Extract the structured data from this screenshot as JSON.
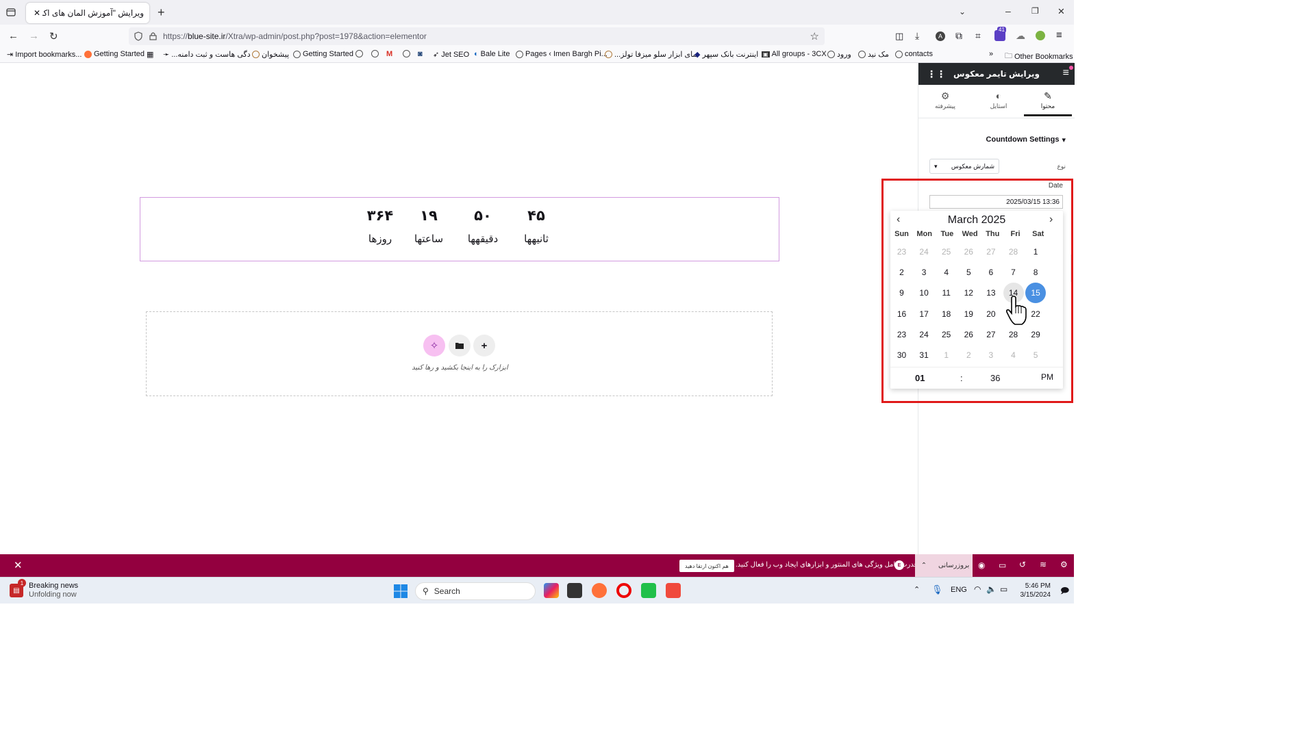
{
  "browser": {
    "tab_title": "ویرایش \"آموزش المان های اکسترا – ...",
    "url_prefix": "https://",
    "url_domain": "blue-site.ir",
    "url_path": "/Xtra/wp-admin/post.php?post=1978&action=elementor",
    "extension_badge": "41"
  },
  "bookmarks": {
    "items": [
      "Import bookmarks...",
      "Getting Started",
      "...دگی هاست و ثبت دامنه",
      "پیشخوان",
      "Getting Started",
      "Jet SEO",
      "Bale Lite",
      "Pages ‹ Imen Bargh Pi...",
      "...نمای ابزار سلو میزفا تولز",
      "اینترنت بانک سپهر",
      "All groups - 3CX",
      "ورود",
      "مک نید",
      "contacts"
    ],
    "other": "Other Bookmarks"
  },
  "countdown": {
    "units": [
      {
        "number": "۴۵",
        "label": "ثانیهها"
      },
      {
        "number": "۵۰",
        "label": "دقیقهها"
      },
      {
        "number": "۱۹",
        "label": "ساعتها"
      },
      {
        "number": "۳۶۴",
        "label": "روزها"
      }
    ]
  },
  "dropzone": {
    "hint": "ابزارک را به اینجا بکشید و رها کنید"
  },
  "panel": {
    "title": "ویرایش تایمر معکوس",
    "tabs": {
      "content": "محتوا",
      "style": "استایل",
      "advanced": "پیشرفته"
    },
    "section_title": "Countdown Settings",
    "type_label": "نوع",
    "type_value": "شمارش معکوس",
    "date_label": "Date",
    "date_value": "2025/03/15 13:36"
  },
  "datepicker": {
    "month_year": "March 2025",
    "weekdays": [
      "Sun",
      "Mon",
      "Tue",
      "Wed",
      "Thu",
      "Fri",
      "Sat"
    ],
    "weeks": [
      [
        "23",
        "24",
        "25",
        "26",
        "27",
        "28",
        "1"
      ],
      [
        "2",
        "3",
        "4",
        "5",
        "6",
        "7",
        "8"
      ],
      [
        "9",
        "10",
        "11",
        "12",
        "13",
        "14",
        "15"
      ],
      [
        "16",
        "17",
        "18",
        "19",
        "20",
        "21",
        "22"
      ],
      [
        "23",
        "24",
        "25",
        "26",
        "27",
        "28",
        "29"
      ],
      [
        "30",
        "31",
        "1",
        "2",
        "3",
        "4",
        "5"
      ]
    ],
    "selected_day": "15",
    "hovered_day": "14",
    "hour": "01",
    "separator": ":",
    "minute": "36",
    "ampm": "PM"
  },
  "notification": {
    "text": "قدرت کامل ویژگی های المنتور و ابزارهای ایجاد وب را فعال کنید.",
    "button": "هم اکنون ارتقا دهید",
    "update_label": "بروزرسانی"
  },
  "taskbar": {
    "news_badge": "1",
    "news_title": "Breaking news",
    "news_subtitle": "Unfolding now",
    "search_placeholder": "Search",
    "language": "ENG",
    "time": "5:46 PM",
    "date": "3/15/2024"
  },
  "colors": {
    "selected_day": "#4a90e2",
    "notify_bar": "#93003f",
    "highlight_box": "#e01919",
    "panel_header": "#26292c"
  }
}
